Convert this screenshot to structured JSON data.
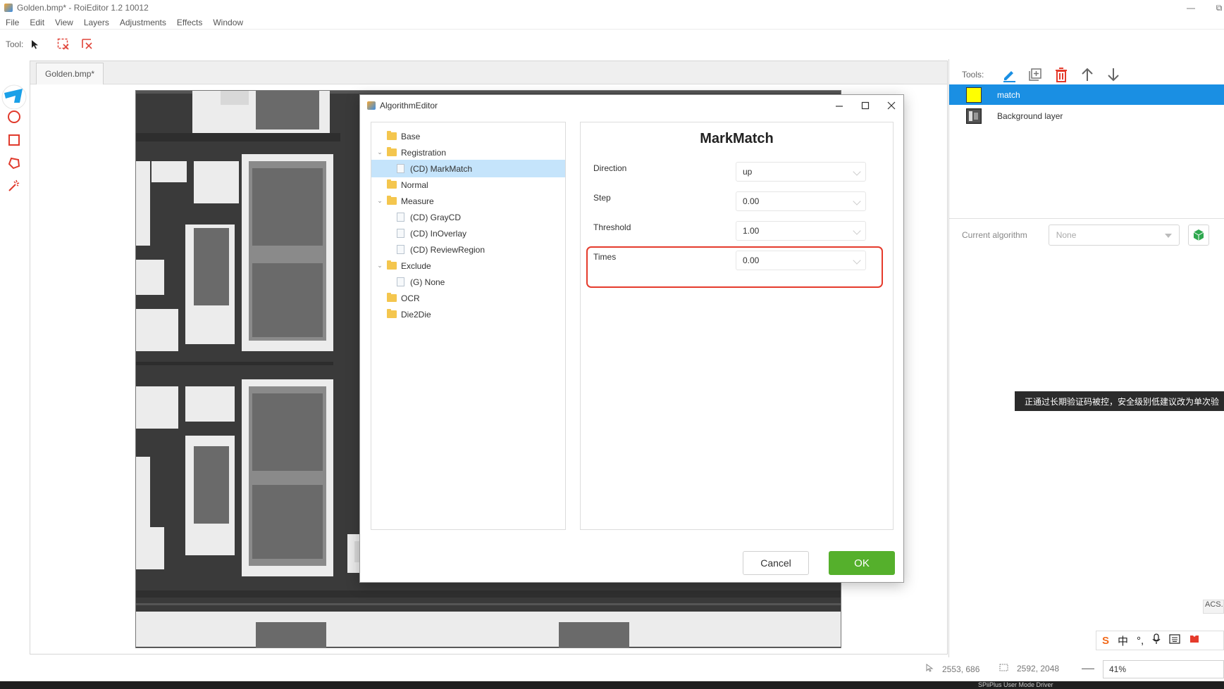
{
  "window": {
    "title": "Golden.bmp* - RoiEditor 1.2 10012",
    "minimize": "—",
    "restore": "⧉"
  },
  "menu": [
    "File",
    "Edit",
    "View",
    "Layers",
    "Adjustments",
    "Effects",
    "Window"
  ],
  "toolbar": {
    "label": "Tool:"
  },
  "document": {
    "tab": "Golden.bmp*"
  },
  "right_panel": {
    "tools_label": "Tools:",
    "layers": [
      {
        "name": "match",
        "color": "#ffff00",
        "selected": true
      },
      {
        "name": "Background layer",
        "selected": false
      }
    ],
    "current_algorithm_label": "Current algorithm",
    "current_algorithm_value": "None"
  },
  "tooltip": "正通过长期验证码被控，安全级别低建议改为单次验",
  "dialog": {
    "title": "AlgorithmEditor",
    "tree": [
      {
        "label": "Base",
        "type": "folder",
        "level": 0,
        "expandable": false
      },
      {
        "label": "Registration",
        "type": "folder",
        "level": 0,
        "expandable": true
      },
      {
        "label": "(CD) MarkMatch",
        "type": "file",
        "level": 1,
        "selected": true
      },
      {
        "label": "Normal",
        "type": "folder",
        "level": 0,
        "expandable": false
      },
      {
        "label": "Measure",
        "type": "folder",
        "level": 0,
        "expandable": true
      },
      {
        "label": "(CD) GrayCD",
        "type": "file",
        "level": 1
      },
      {
        "label": "(CD) InOverlay",
        "type": "file",
        "level": 1
      },
      {
        "label": "(CD) ReviewRegion",
        "type": "file",
        "level": 1
      },
      {
        "label": "Exclude",
        "type": "folder",
        "level": 0,
        "expandable": true
      },
      {
        "label": "(G) None",
        "type": "file",
        "level": 1
      },
      {
        "label": "OCR",
        "type": "folder",
        "level": 0,
        "expandable": false
      },
      {
        "label": "Die2Die",
        "type": "folder",
        "level": 0,
        "expandable": false
      }
    ],
    "props_title": "MarkMatch",
    "params": [
      {
        "label": "Direction",
        "value": "up"
      },
      {
        "label": "Step",
        "value": "0.00"
      },
      {
        "label": "Threshold",
        "value": "1.00",
        "highlighted": true
      },
      {
        "label": "Times",
        "value": "0.00"
      }
    ],
    "cancel_label": "Cancel",
    "ok_label": "OK"
  },
  "status": {
    "cursor_pos": "2553, 686",
    "image_size": "2592, 2048",
    "zoom": "41%"
  },
  "ime": {
    "chinese_mode": "中"
  },
  "side_tab": "ACS.E",
  "taskbar_hint": "SPiiPlus User Mode Driver",
  "colors": {
    "accent": "#1a8fe3",
    "ok_button": "#55b02c",
    "highlight_border": "#e53b2c",
    "delete_icon": "#e53b2c"
  }
}
